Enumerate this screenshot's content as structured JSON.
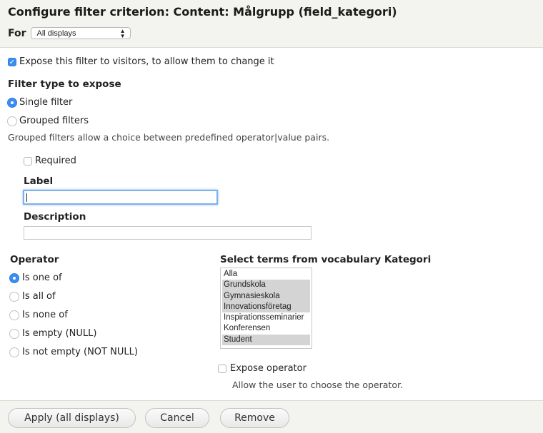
{
  "header": {
    "title": "Configure filter criterion: Content: Målgrupp (field_kategori)",
    "for_label": "For",
    "for_select": {
      "selected": "All displays",
      "icon": "select-updown-arrows"
    }
  },
  "expose": {
    "label": "Expose this filter to visitors, to allow them to change it",
    "checked": true
  },
  "filter_type": {
    "heading": "Filter type to expose",
    "options": [
      {
        "label": "Single filter",
        "selected": true
      },
      {
        "label": "Grouped filters",
        "selected": false
      }
    ],
    "description": "Grouped filters allow a choice between predefined operator|value pairs."
  },
  "required": {
    "label": "Required",
    "checked": false
  },
  "label_field": {
    "heading": "Label",
    "value": ""
  },
  "description_field": {
    "heading": "Description",
    "value": ""
  },
  "operator": {
    "heading": "Operator",
    "options": [
      {
        "label": "Is one of",
        "selected": true
      },
      {
        "label": "Is all of",
        "selected": false
      },
      {
        "label": "Is none of",
        "selected": false
      },
      {
        "label": "Is empty (NULL)",
        "selected": false
      },
      {
        "label": "Is not empty (NOT NULL)",
        "selected": false
      }
    ]
  },
  "terms": {
    "heading": "Select terms from vocabulary Kategori",
    "options": [
      {
        "label": "Alla",
        "selected": false
      },
      {
        "label": "Grundskola",
        "selected": true
      },
      {
        "label": "Gymnasieskola",
        "selected": true
      },
      {
        "label": "Innovationsföretag",
        "selected": true
      },
      {
        "label": "Inspirationsseminarier",
        "selected": false
      },
      {
        "label": "Konferensen",
        "selected": false
      },
      {
        "label": "Student",
        "selected": true
      }
    ]
  },
  "expose_operator": {
    "label": "Expose operator",
    "checked": false,
    "description": "Allow the user to choose the operator."
  },
  "footer": {
    "apply_label": "Apply (all displays)",
    "cancel_label": "Cancel",
    "remove_label": "Remove"
  }
}
